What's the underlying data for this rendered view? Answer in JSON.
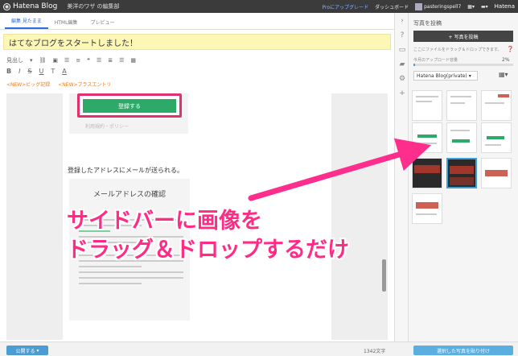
{
  "topbar": {
    "logo": "Hatena Blog",
    "blog_name": "美洋のワザ の編集部",
    "upgrade_label": "Proにアップグレード",
    "dashboard_label": "ダッシュボード",
    "user_label": "pasteringspell7",
    "brand": "Hatena"
  },
  "editor": {
    "tabs": [
      {
        "label": "編集 見たまま"
      },
      {
        "label": "HTML編集"
      },
      {
        "label": "プレビュー"
      }
    ],
    "title": "はてなブログをスタートしました！",
    "font_size_label": "見出し",
    "tags": [
      "<NEW>ビッグ記録",
      "<NEW>ブラスエントリ"
    ],
    "shot_button": "登録する",
    "shot_link": "利用規約・ポリシー",
    "body_text": "登録したアドレスにメールが送られる。",
    "shot2_title": "メールアドレスの確認",
    "overlay_line1": "サイドバーに画像を",
    "overlay_line2": "ドラッグ＆ドロップするだけ"
  },
  "bottom": {
    "publish_label": "公開する",
    "word_count": "1342文字",
    "insert_label": "選択した写真を貼り付け"
  },
  "sidebar": {
    "title": "写真を投稿",
    "upload_label": "+ 写真を投稿",
    "note": "ここにファイルをドラッグ＆ドロップできます。",
    "quota_label": "今月のアップロード容量",
    "quota_pct": "2%",
    "quota_value": 0.02,
    "folder_label": "Hatena Blog(private)"
  },
  "colors": {
    "accent_pink": "#ff2b85",
    "arrow_pink": "#ff2d8c",
    "button_green": "#2eaa68",
    "title_bg": "#fdf7b5"
  },
  "icons": [
    "chevron-right-icon",
    "help-icon",
    "blog-icon",
    "folder-icon",
    "gear-icon",
    "plus-icon"
  ]
}
